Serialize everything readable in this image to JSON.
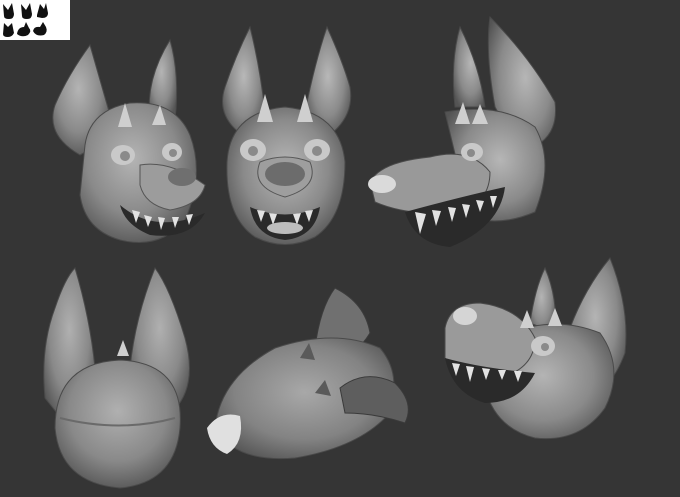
{
  "canvas": {
    "background_color": "#353535",
    "thumbnail": {
      "background_color": "#ffffff",
      "silhouette_color": "#111111",
      "silhouette_count": 6
    }
  },
  "views": [
    {
      "name": "three-quarter-left",
      "facing": "left"
    },
    {
      "name": "front",
      "facing": "front"
    },
    {
      "name": "side-profile",
      "facing": "left"
    },
    {
      "name": "back",
      "facing": "back"
    },
    {
      "name": "bottom",
      "facing": "down"
    },
    {
      "name": "three-quarter-right",
      "facing": "right"
    }
  ],
  "material": {
    "clay_color": "#8e8e8e",
    "clay_shadow": "#555555",
    "clay_highlight": "#cfcfcf",
    "tooth_color": "#e2e2e2",
    "mouth_color": "#2a2a2a"
  }
}
